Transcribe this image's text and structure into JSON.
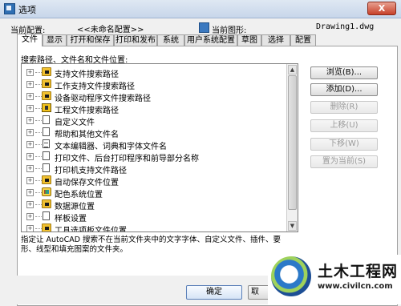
{
  "window": {
    "title": "选项",
    "close_label": "X"
  },
  "profile": {
    "current_profile_label": "当前配置:",
    "current_profile_value": "<<未命名配置>>",
    "current_drawing_label": "当前图形:",
    "current_drawing_value": "Drawing1.dwg"
  },
  "tabs": [
    {
      "label": "文件"
    },
    {
      "label": "显示"
    },
    {
      "label": "打开和保存"
    },
    {
      "label": "打印和发布"
    },
    {
      "label": "系统"
    },
    {
      "label": "用户系统配置"
    },
    {
      "label": "草图"
    },
    {
      "label": "选择"
    },
    {
      "label": "配置"
    }
  ],
  "active_tab": "文件",
  "tree": {
    "label": "搜索路径、文件名和文件位置:",
    "items": [
      {
        "label": "支持文件搜索路径",
        "icon": "folder-icon"
      },
      {
        "label": "工作支持文件搜索路径",
        "icon": "folder-icon"
      },
      {
        "label": "设备驱动程序文件搜索路径",
        "icon": "folder-icon"
      },
      {
        "label": "工程文件搜索路径",
        "icon": "book-icon"
      },
      {
        "label": "自定义文件",
        "icon": "file-icon"
      },
      {
        "label": "帮助和其他文件名",
        "icon": "file-icon"
      },
      {
        "label": "文本编辑器、词典和字体文件名",
        "icon": "file-icon"
      },
      {
        "label": "打印文件、后台打印程序和前导部分名称",
        "icon": "file-icon"
      },
      {
        "label": "打印机支持文件路径",
        "icon": "file-icon"
      },
      {
        "label": "自动保存文件位置",
        "icon": "folder-icon"
      },
      {
        "label": "配色系统位置",
        "icon": "palette-icon"
      },
      {
        "label": "数据源位置",
        "icon": "folder-icon"
      },
      {
        "label": "样板设置",
        "icon": "file-icon"
      },
      {
        "label": "工具选项板文件位置",
        "icon": "folder-icon"
      }
    ]
  },
  "side_buttons": {
    "browse": "浏览(B)...",
    "add": "添加(D)...",
    "remove": "删除(R)",
    "move_up": "上移(U)",
    "move_down": "下移(W)",
    "set_current": "置为当前(S)"
  },
  "description": "指定让 AutoCAD 搜索不在当前文件夹中的文字字体、自定义文件、插件、要形、线型和填充图案的文件夹。",
  "footer": {
    "ok": "确定",
    "cancel": "取"
  },
  "watermark": {
    "title": "土木工程网",
    "url": "www.civilcn.com"
  }
}
